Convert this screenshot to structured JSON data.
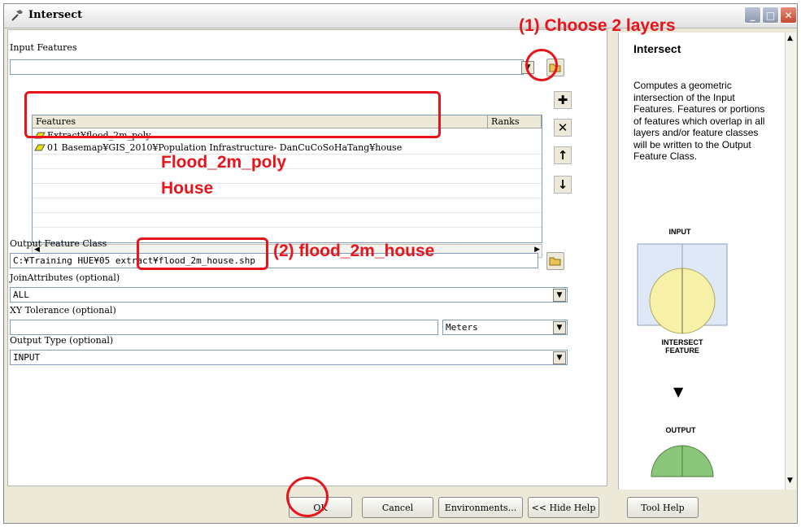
{
  "window": {
    "title": "Intersect"
  },
  "form": {
    "input_features_label": "Input Features",
    "input_features_value": "",
    "table_headers": [
      "Features",
      "Ranks"
    ],
    "features": [
      "Extract¥flood_2m_poly",
      "01 Basemap¥GIS_2010¥Population Infrastructure- DanCuCoSoHaTang¥house"
    ],
    "output_label": "Output Feature Class",
    "output_value": "C:¥Training HUE¥05 extract¥flood_2m_house.shp",
    "join_label": "JoinAttributes (optional)",
    "join_value": "ALL",
    "xy_label": "XY Tolerance (optional)",
    "xy_value": "",
    "xy_unit": "Meters",
    "type_label": "Output Type (optional)",
    "type_value": "INPUT"
  },
  "annotations": {
    "step1": "(1)  Choose 2 layers",
    "layer1": "Flood_2m_poly",
    "layer2": "House",
    "step2": "(2)  flood_2m_house"
  },
  "help": {
    "title": "Intersect",
    "body": "Computes a geometric intersection of the Input Features. Features or portions of features which overlap in all layers and/or feature classes will be written to the Output Feature Class.",
    "diagram_input": "INPUT",
    "diagram_intersect": "INTERSECT FEATURE",
    "diagram_output": "OUTPUT"
  },
  "buttons": {
    "ok": "OK",
    "cancel": "Cancel",
    "environments": "Environments...",
    "hide_help": "<< Hide Help",
    "tool_help": "Tool Help"
  },
  "colors": {
    "annotation_red": "#e8141c",
    "diagram_yellow": "#f7f1a8",
    "diagram_green": "#8bc77a"
  }
}
